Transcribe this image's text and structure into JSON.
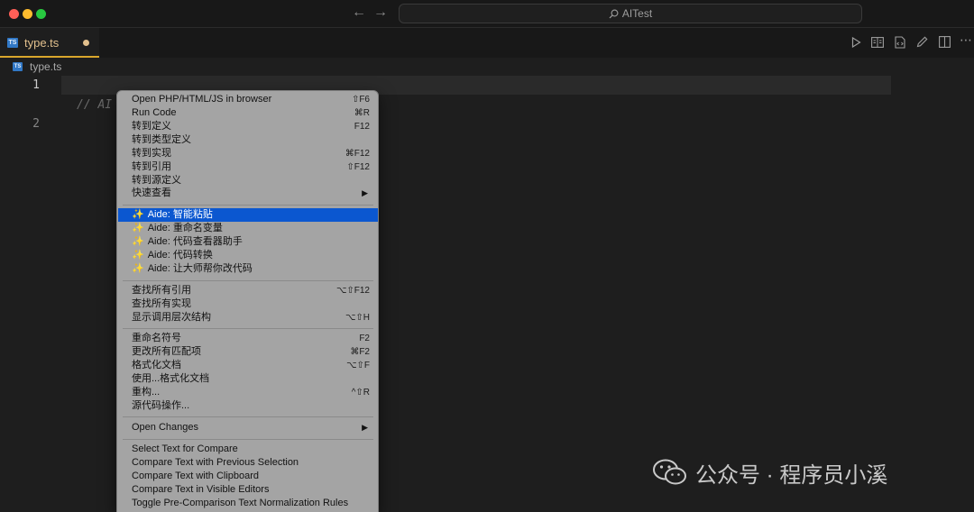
{
  "titlebar": {
    "search_text": "AITest",
    "icons": [
      "back-arrow-icon",
      "forward-arrow-icon",
      "search-icon"
    ]
  },
  "tabs": [
    {
      "label": "type.ts",
      "icon": "ts-file-icon",
      "modified": true
    }
  ],
  "toolbar": {
    "icons": [
      "run-icon",
      "open-preview-icon",
      "source-view-icon",
      "edit-pen-icon",
      "split-editor-icon",
      "more-actions-icon"
    ]
  },
  "breadcrumb": {
    "label": "type.ts"
  },
  "editor": {
    "line_numbers": [
      "1",
      "2"
    ],
    "ghost_text": "// AI"
  },
  "context_menu": {
    "items": [
      {
        "label": "Open PHP/HTML/JS in browser",
        "shortcut": "⇧F6"
      },
      {
        "label": "Run Code",
        "shortcut": "⌘R"
      },
      {
        "label": "转到定义",
        "shortcut": "F12"
      },
      {
        "label": "转到类型定义",
        "shortcut": ""
      },
      {
        "label": "转到实现",
        "shortcut": "⌘F12"
      },
      {
        "label": "转到引用",
        "shortcut": "⇧F12"
      },
      {
        "label": "转到源定义",
        "shortcut": ""
      },
      {
        "label": "快速查看",
        "shortcut": "▶"
      },
      {
        "label": "Aide: 智能粘贴",
        "shortcut": ""
      },
      {
        "label": "Aide: 重命名变量",
        "shortcut": ""
      },
      {
        "label": "Aide: 代码查看器助手",
        "shortcut": ""
      },
      {
        "label": "Aide: 代码转换",
        "shortcut": ""
      },
      {
        "label": "Aide: 让大师帮你改代码",
        "shortcut": ""
      },
      {
        "label": "查找所有引用",
        "shortcut": "⌥⇧F12"
      },
      {
        "label": "查找所有实现",
        "shortcut": ""
      },
      {
        "label": "显示调用层次结构",
        "shortcut": "⌥⇧H"
      },
      {
        "label": "重命名符号",
        "shortcut": "F2"
      },
      {
        "label": "更改所有匹配项",
        "shortcut": "⌘F2"
      },
      {
        "label": "格式化文档",
        "shortcut": "⌥⇧F"
      },
      {
        "label": "使用...格式化文档",
        "shortcut": ""
      },
      {
        "label": "重构...",
        "shortcut": "^⇧R"
      },
      {
        "label": "源代码操作...",
        "shortcut": ""
      },
      {
        "label": "Open Changes",
        "shortcut": "▶"
      },
      {
        "label": "Select Text for Compare",
        "shortcut": ""
      },
      {
        "label": "Compare Text with Previous Selection",
        "shortcut": ""
      },
      {
        "label": "Compare Text with Clipboard",
        "shortcut": ""
      },
      {
        "label": "Compare Text in Visible Editors",
        "shortcut": ""
      },
      {
        "label": "Toggle Pre-Comparison Text Normalization Rules",
        "shortcut": ""
      }
    ],
    "selected_label": "Aide: 智能粘贴",
    "sparkle_icon": "✨"
  },
  "watermark": {
    "text": "公众号 · 程序员小溪"
  },
  "colors": {
    "accent_tab": "#d9a62c",
    "selection": "#0b57d0",
    "menu_bg": "#a4a4a4",
    "editor_bg": "#1e1e1e"
  }
}
